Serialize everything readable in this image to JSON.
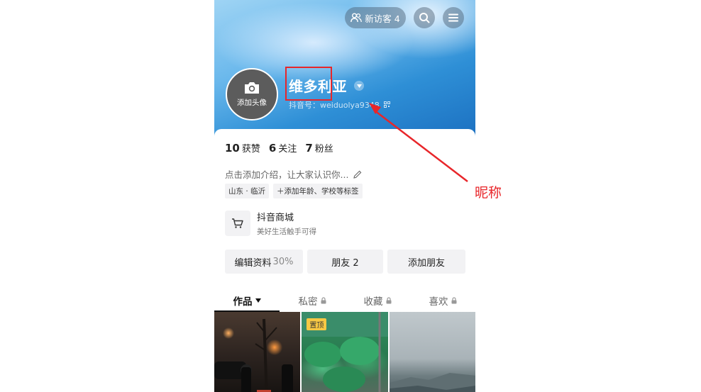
{
  "header": {
    "visitors_label": "新访客 4",
    "colors": {
      "accent_red": "#e8262a"
    }
  },
  "profile": {
    "avatar_label": "添加头像",
    "nickname": "维多利亚",
    "douyin_id": "抖音号：weiduolya9348"
  },
  "stats": {
    "likes_value": "10",
    "likes_label": "获赞",
    "following_value": "6",
    "following_label": "关注",
    "fans_value": "7",
    "fans_label": "粉丝"
  },
  "bio": {
    "placeholder": "点击添加介绍，让大家认识你..."
  },
  "tags": [
    "山东 · 临沂",
    "＋添加年龄、学校等标签"
  ],
  "mall": {
    "title": "抖音商城",
    "subtitle": "美好生活触手可得"
  },
  "buttons": {
    "edit_profile": "编辑资料",
    "edit_profile_pct": "30%",
    "friends": "朋友 2",
    "add_friend": "添加朋友"
  },
  "tabs": [
    "作品",
    "私密",
    "收藏",
    "喜欢"
  ],
  "videos": {
    "pinned_label": "置顶"
  },
  "annotation": {
    "label": "昵称"
  }
}
